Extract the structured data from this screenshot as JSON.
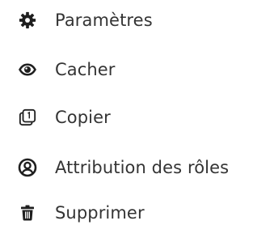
{
  "menu": {
    "items": [
      {
        "label": "Paramètres",
        "icon": "gear-icon"
      },
      {
        "label": "Cacher",
        "icon": "eye-icon"
      },
      {
        "label": "Copier",
        "icon": "copy-icon"
      },
      {
        "label": "Attribution des rôles",
        "icon": "user-circle-icon"
      },
      {
        "label": "Supprimer",
        "icon": "trash-icon"
      }
    ]
  },
  "colors": {
    "text": "#343434",
    "icon": "#1f1f1f",
    "background": "#ffffff"
  }
}
